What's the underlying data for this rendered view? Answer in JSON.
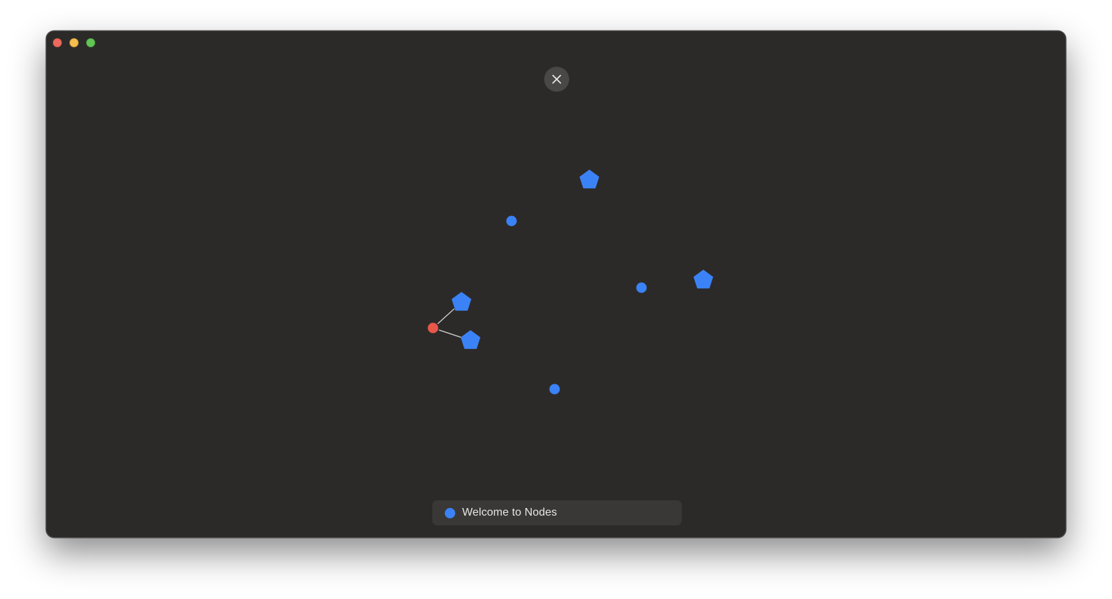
{
  "window": {
    "background": "#2c2a29"
  },
  "traffic_lights": [
    {
      "name": "close",
      "color": "#ed6a5e"
    },
    {
      "name": "minimize",
      "color": "#f5bf4f"
    },
    {
      "name": "zoom",
      "color": "#62c555"
    }
  ],
  "close_button": {
    "icon": "close-icon"
  },
  "graph": {
    "node_color": "#3b82f6",
    "selected_color": "#e9564b",
    "edge_color": "#cfccc8",
    "nodes": [
      {
        "id": "n1",
        "shape": "pentagon"
      },
      {
        "id": "n2",
        "shape": "circle"
      },
      {
        "id": "n3",
        "shape": "circle"
      },
      {
        "id": "n4",
        "shape": "pentagon"
      },
      {
        "id": "n5",
        "shape": "pentagon"
      },
      {
        "id": "n6",
        "shape": "circle",
        "selected": true
      },
      {
        "id": "n7",
        "shape": "pentagon"
      },
      {
        "id": "n8",
        "shape": "circle"
      }
    ],
    "edges": [
      {
        "from": "n6",
        "to": "n5"
      },
      {
        "from": "n6",
        "to": "n7"
      }
    ]
  },
  "status_bar": {
    "dot_color": "#3b82f6",
    "text": "Welcome to Nodes"
  }
}
